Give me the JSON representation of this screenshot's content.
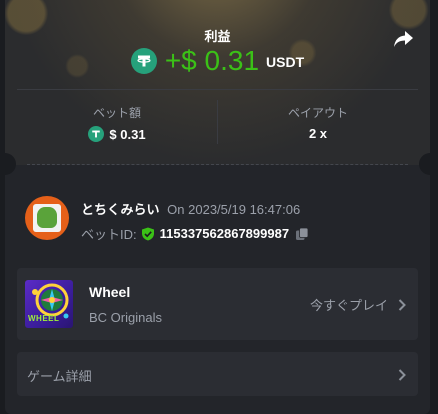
{
  "header": {
    "title": "利益",
    "amount": "+$ 0.31",
    "currency": "USDT",
    "share_icon": "share-arrow-icon"
  },
  "stats": [
    {
      "label": "ベット額",
      "value": "$ 0.31",
      "icon": "usdt-coin-icon"
    },
    {
      "label": "ペイアウト",
      "value": "2 x"
    }
  ],
  "user": {
    "name": "とちくみらい",
    "on": "On",
    "datetime": "2023/5/19 16:47:06",
    "bet_id_label": "ベットID:",
    "bet_id": "115337562867899987"
  },
  "game": {
    "name": "Wheel",
    "provider": "BC Originals",
    "thumb_text": "WHEEL",
    "play_label": "今すぐプレイ"
  },
  "details": {
    "label": "ゲーム詳細"
  },
  "colors": {
    "profit_green": "#3bc117",
    "usdt_green": "#26a17b",
    "card_bg": "#23252a",
    "muted_text": "#9ba0aa"
  }
}
